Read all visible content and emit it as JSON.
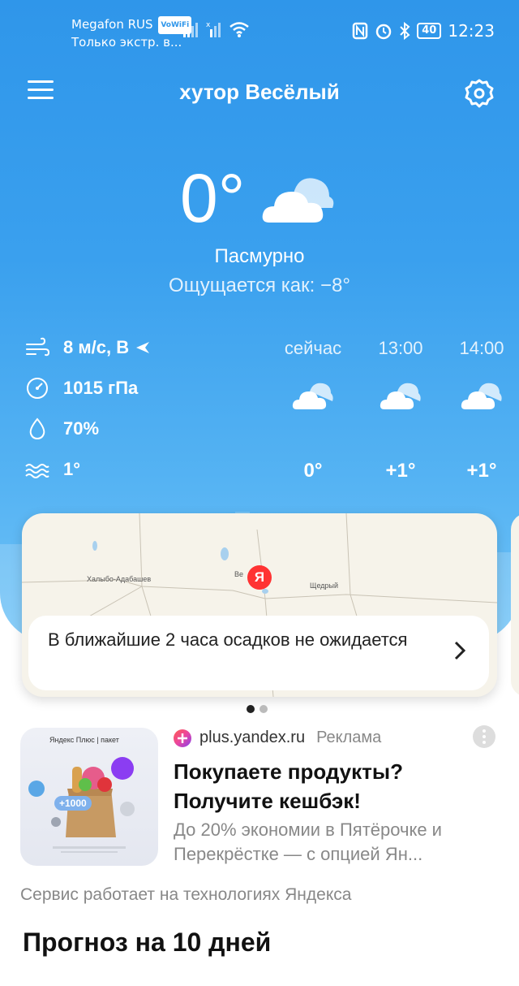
{
  "status_bar": {
    "carrier": "Megafon RUS",
    "vowifi": "VoWiFi",
    "emergency": "Только экстр. в...",
    "battery": "40",
    "time": "12:23"
  },
  "header": {
    "location": "хутор Весёлый",
    "menu_icon": "menu-icon",
    "settings_icon": "gear-icon"
  },
  "current": {
    "temperature": "0°",
    "condition": "Пасмурно",
    "feels_like": "Ощущается как: −8°",
    "icon": "cloud-icon"
  },
  "details": {
    "wind": "8 м/с, В",
    "pressure": "1015 гПа",
    "humidity": "70%",
    "water": "1°"
  },
  "hourly": [
    {
      "time": "сейчас",
      "temp": "0°"
    },
    {
      "time": "13:00",
      "temp": "+1°"
    },
    {
      "time": "14:00",
      "temp": "+1°"
    }
  ],
  "map": {
    "labels": [
      "Халыбо-Адабашев",
      "Ве",
      "Щедрый"
    ],
    "pin": "Я",
    "precip_text": "В ближайшие 2 часа осадков не ожидается"
  },
  "ad": {
    "domain": "plus.yandex.ru",
    "tag": "Реклама",
    "title": "Покупаете продукты? Получите кешбэк!",
    "description": "До 20% экономии в Пятёрочке и Перекрёстке — с опцией Ян...",
    "image_badge": "+1000",
    "image_brand": "Яндекс Плюс | пакет"
  },
  "footer": {
    "service": "Сервис работает на технологиях Яндекса",
    "forecast_title": "Прогноз на 10 дней"
  },
  "colors": {
    "sky_top": "#2f96ea",
    "sky_bottom": "#70c3f7",
    "pin": "#ff3333"
  }
}
